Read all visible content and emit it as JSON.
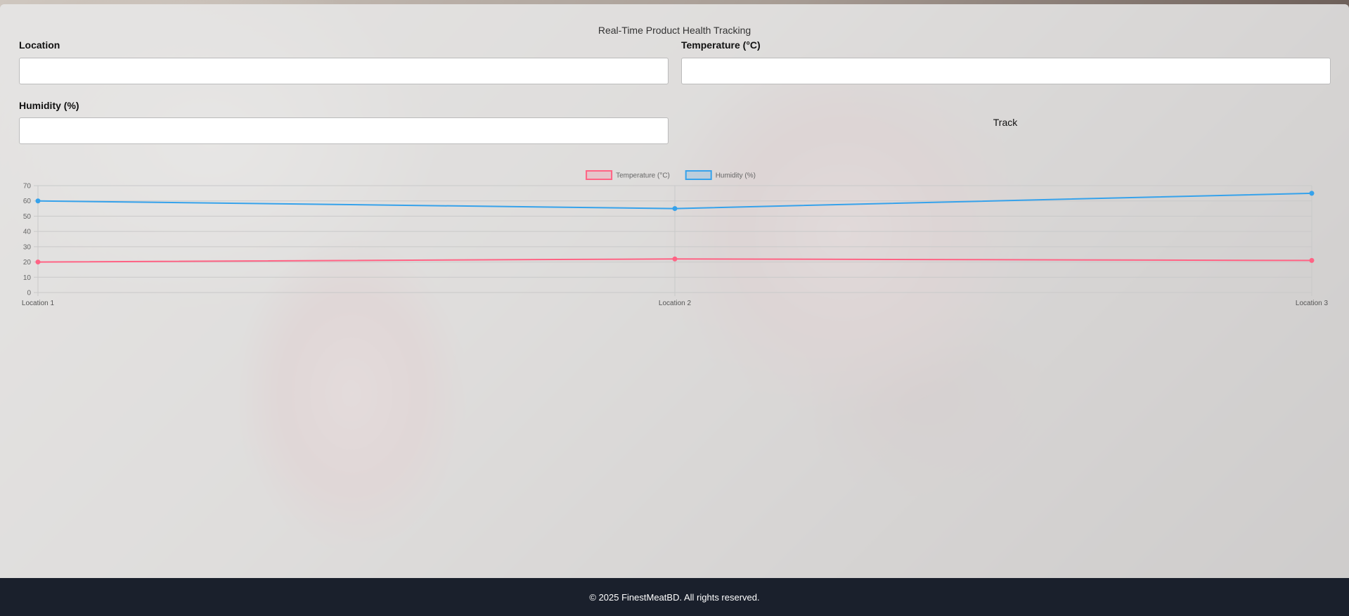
{
  "page": {
    "title": "Real-Time Product Health Tracking"
  },
  "form": {
    "location_label": "Location",
    "location_value": "",
    "temperature_label": "Temperature (°C)",
    "temperature_value": "",
    "humidity_label": "Humidity (%)",
    "humidity_value": "",
    "track_label": "Track"
  },
  "chart_data": {
    "type": "line",
    "categories": [
      "Location 1",
      "Location 2",
      "Location 3"
    ],
    "series": [
      {
        "name": "Temperature (°C)",
        "values": [
          20,
          22,
          21
        ],
        "color": "#ff6384"
      },
      {
        "name": "Humidity (%)",
        "values": [
          60,
          55,
          65
        ],
        "color": "#36a2eb"
      }
    ],
    "ylim": [
      0,
      70
    ],
    "yticks": [
      0,
      10,
      20,
      30,
      40,
      50,
      60,
      70
    ],
    "grid": true,
    "legend": "top-center"
  },
  "footer": {
    "text": "© 2025 FinestMeatBD. All rights reserved."
  }
}
